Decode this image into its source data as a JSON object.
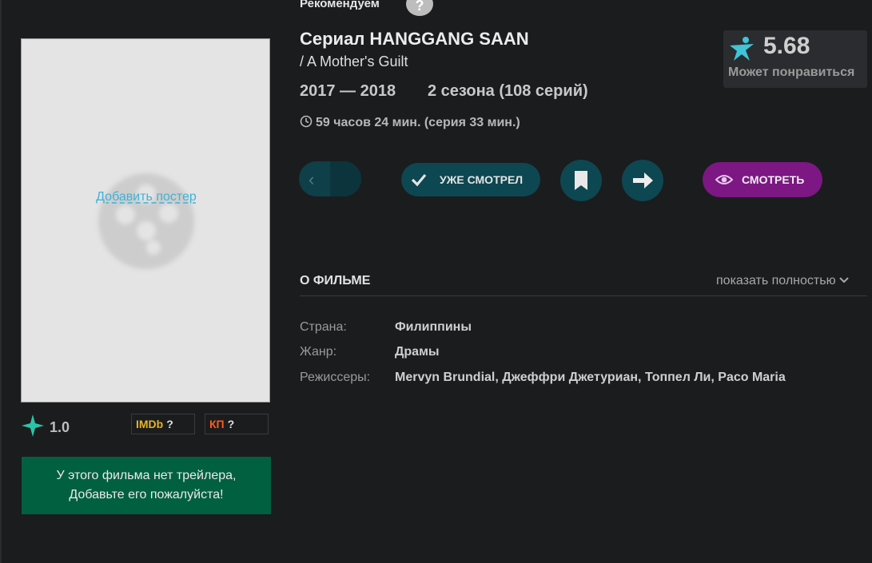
{
  "header": {
    "recommend_label": "Рекомендуем",
    "help_glyph": "?"
  },
  "film": {
    "title": "Сериал HANGGANG SAAN",
    "original_title": "/ A Mother's Guilt",
    "years": "2017 — 2018",
    "seasons": "2 сезона (108 серий)",
    "duration": "59 часов 24 мин. (серия 33 мин.)"
  },
  "score": {
    "value": "5.68",
    "label": "Может понравиться"
  },
  "actions": {
    "prev_glyph": "‹",
    "seen_label": "УЖЕ СМОТРЕЛ",
    "watch_label": "СМОТРЕТЬ"
  },
  "poster": {
    "add_label": "Добавить постер"
  },
  "ratings": {
    "user_rating": "1.0",
    "imdb_label": "IMDb",
    "imdb_value": "?",
    "kp_label": "КП",
    "kp_value": "?"
  },
  "trailer": {
    "line1": "У этого фильма нет трейлера,",
    "line2": "Добавьте его пожалуйста!"
  },
  "about": {
    "heading": "О ФИЛЬМЕ",
    "show_full": "показать полностью",
    "rows": [
      {
        "label": "Страна:",
        "value": "Филиппины"
      },
      {
        "label": "Жанр:",
        "value": "Драмы"
      },
      {
        "label": "Режиссеры:",
        "value": "Mervyn Brundial,  Джеффри Джетуриан,  Топпел Ли,  Paco Maria"
      }
    ]
  },
  "colors": {
    "accent_teal": "#0d4751",
    "accent_purple": "#7c1783",
    "trailer_green": "#006040",
    "star_cyan": "#3fc4d8"
  }
}
